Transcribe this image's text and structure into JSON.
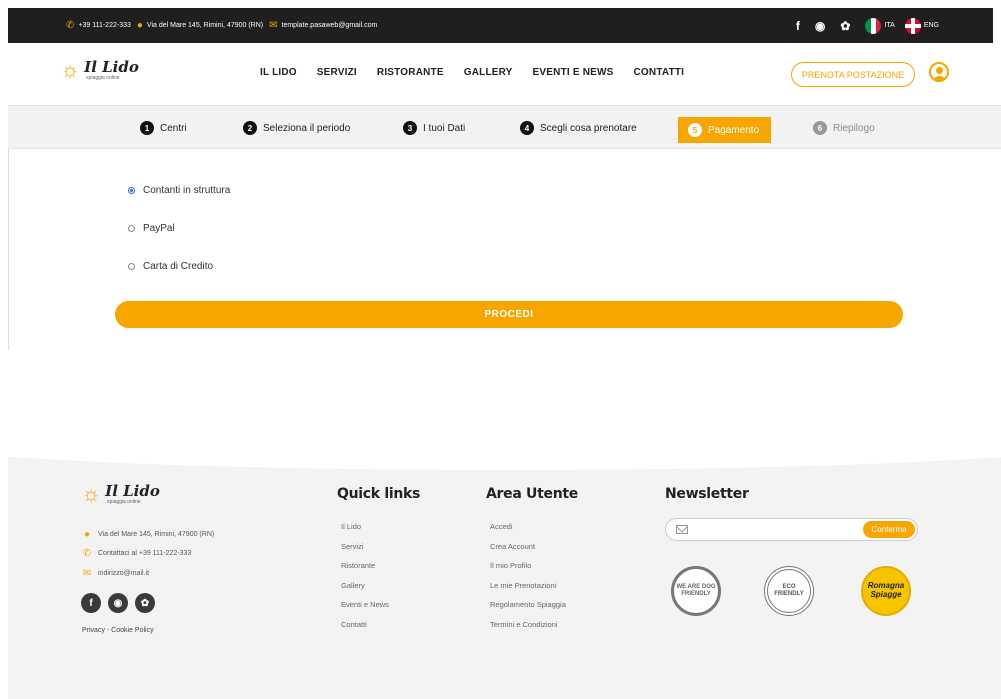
{
  "topbar": {
    "phone": "+39 111-222-333",
    "address": "Via del Mare 145, Rimini, 47900 (RN)",
    "email": "template.pasaweb@gmail.com",
    "lang_ita": "ITA",
    "lang_eng": "ENG"
  },
  "header": {
    "logo_title": "Il Lido",
    "logo_sub": "spiaggia online",
    "nav": [
      "IL LIDO",
      "SERVIZI",
      "RISTORANTE",
      "GALLERY",
      "EVENTI E NEWS",
      "CONTATTI"
    ],
    "prenota_label": "PRENOTA POSTAZIONE"
  },
  "steps": [
    {
      "num": "1",
      "label": "Centri"
    },
    {
      "num": "2",
      "label": "Seleziona il periodo"
    },
    {
      "num": "3",
      "label": "I tuoi Dati"
    },
    {
      "num": "4",
      "label": "Scegli cosa prenotare"
    },
    {
      "num": "5",
      "label": "Pagamento"
    },
    {
      "num": "6",
      "label": "Riepilogo"
    }
  ],
  "payment": {
    "options": [
      "Contanti in struttura",
      "PayPal",
      "Carta di Credito"
    ],
    "selected": "Contanti in struttura",
    "submit_label": "PROCEDI"
  },
  "footer": {
    "logo_title": "Il Lido",
    "logo_sub": "spiaggia online",
    "address": "Via del Mare 145, Rimini, 47900 (RN)",
    "phone": "Contattaci al +39 111-222-333",
    "email": "indirizzo@mail.it",
    "privacy": "Privacy - Cookie Policy",
    "quick_links_title": "Quick links",
    "quick_links": [
      "Il Lido",
      "Servizi",
      "Ristorante",
      "Gallery",
      "Eventi e News",
      "Contatti"
    ],
    "area_title": "Area Utente",
    "area_links": [
      "Accedi",
      "Crea Account",
      "Il mio Profilo",
      "Le mie Prenotazioni",
      "Regolamento Spiaggia",
      "Termini e Condizioni"
    ],
    "newsletter_title": "Newsletter",
    "newsletter_button": "Conferma",
    "badge_dog": "WE ARE DOG FRIENDLY",
    "badge_eco": "ECO FRIENDLY",
    "badge_romagna": "Romagna Spiagge"
  },
  "colors": {
    "accent": "#f7a600",
    "topbar_bg": "#1f1f1f",
    "radio_checked": "#2a6ed8"
  }
}
